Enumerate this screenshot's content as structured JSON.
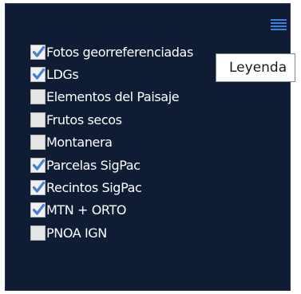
{
  "tooltip": {
    "text": "Leyenda"
  },
  "menu": {
    "icon": "hamburger-menu-icon"
  },
  "layers": [
    {
      "label": "Fotos georreferenciadas",
      "checked": true
    },
    {
      "label": "LDGs",
      "checked": true
    },
    {
      "label": "Elementos del Paisaje",
      "checked": false
    },
    {
      "label": "Frutos secos",
      "checked": false
    },
    {
      "label": "Montanera",
      "checked": false
    },
    {
      "label": "Parcelas SigPac",
      "checked": true
    },
    {
      "label": "Recintos SigPac",
      "checked": true
    },
    {
      "label": "MTN + ORTO",
      "checked": true
    },
    {
      "label": "PNOA IGN",
      "checked": false
    }
  ],
  "colors": {
    "panel": "#0f1c33",
    "check": "#4a7fd4",
    "menu": "#3b7fe0"
  }
}
